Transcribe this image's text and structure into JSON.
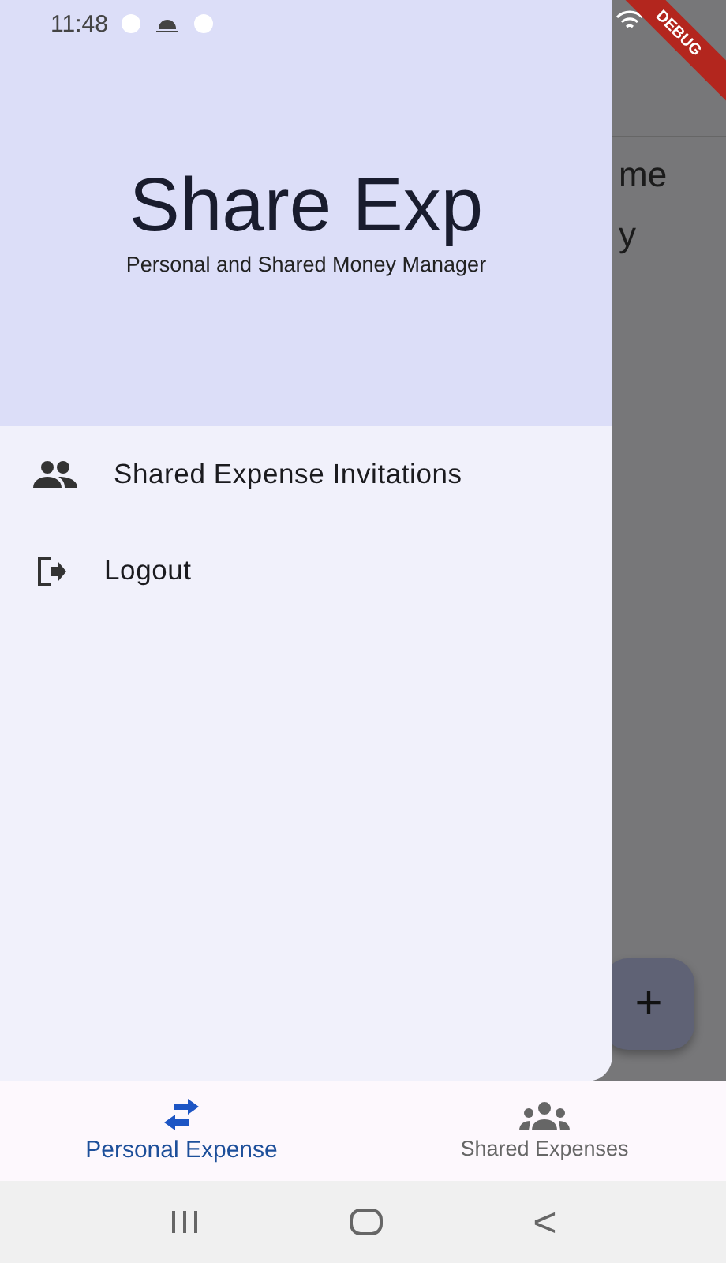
{
  "status_bar": {
    "time": "11:48"
  },
  "debug_banner": {
    "label": "DEBUG"
  },
  "background_page": {
    "texts": [
      "me",
      "y"
    ],
    "fab": {
      "label": "+"
    }
  },
  "drawer": {
    "title": "Share Exp",
    "subtitle": "Personal and Shared Money Manager",
    "items": [
      {
        "kind": "group",
        "label": "Shared Expense Invitations"
      },
      {
        "kind": "logout",
        "label": "Logout"
      }
    ]
  },
  "bottom_nav": [
    {
      "kind": "swap",
      "label": "Personal Expense",
      "selected": true
    },
    {
      "kind": "group",
      "label": "Shared Expenses",
      "selected": false
    }
  ],
  "system_nav": {
    "back": "<"
  }
}
